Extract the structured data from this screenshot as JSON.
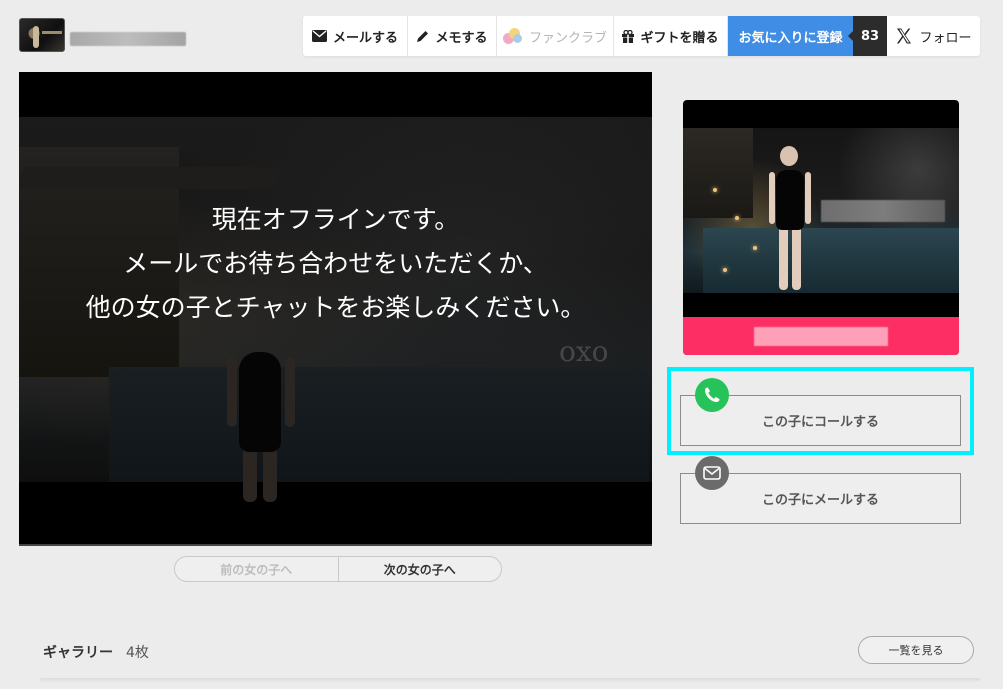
{
  "toolbar": {
    "mail_label": "メールする",
    "memo_label": "メモする",
    "fanclub_label": "ファンクラブ",
    "gift_label": "ギフトを贈る",
    "favorite_label": "お気に入りに登録",
    "favorite_count": "83",
    "follow_label": "フォロー",
    "favorite_color": "#3f8de4"
  },
  "video": {
    "offline_lines": [
      "現在オフラインです。",
      "メールでお待ち合わせをいただくか、",
      "他の女の子とチャットをお楽しみください。"
    ],
    "watermark": "oxo"
  },
  "nav": {
    "prev_label": "前の女の子へ",
    "next_label": "次の女の子へ"
  },
  "profile": {
    "name_bar_color": "#fc2e64"
  },
  "actions": {
    "call_label": "この子にコールする",
    "mail_label": "この子にメールする",
    "call_icon": "phone-icon",
    "mail_icon": "envelope-icon",
    "call_icon_color": "#27c35a"
  },
  "gallery": {
    "title": "ギャラリー",
    "count": "4枚",
    "view_all_label": "一覧を見る"
  }
}
